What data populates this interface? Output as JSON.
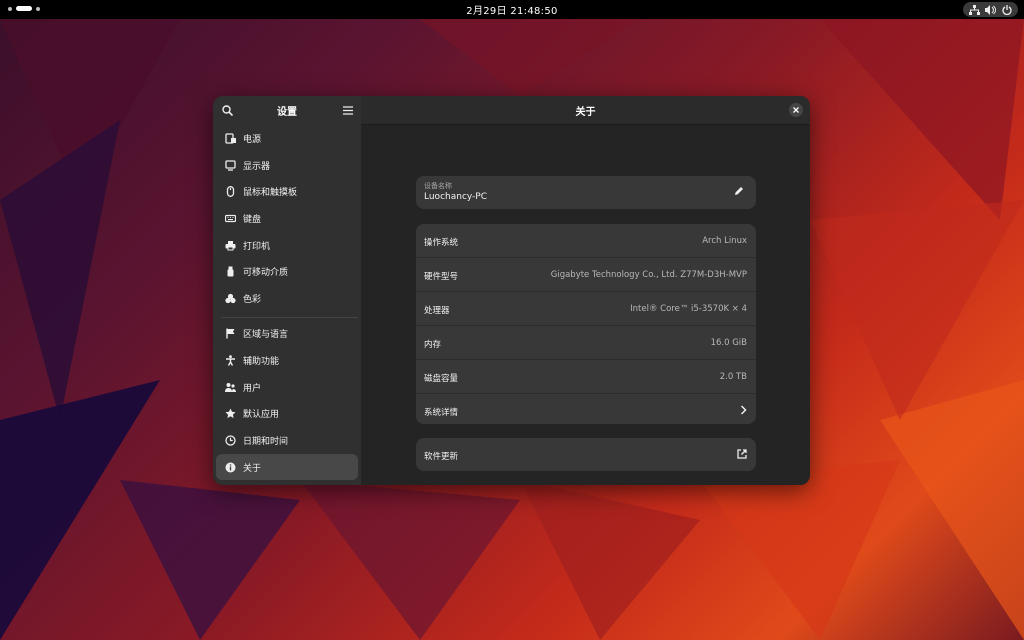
{
  "topbar": {
    "clock": "2月29日  21:48:50",
    "tray_icons": [
      "network-icon",
      "volume-icon",
      "power-icon"
    ]
  },
  "sidebar": {
    "title": "设置",
    "items": [
      {
        "label": "电源",
        "icon": "power-battery-icon"
      },
      {
        "label": "显示器",
        "icon": "display-icon"
      },
      {
        "label": "鼠标和触摸板",
        "icon": "mouse-icon"
      },
      {
        "label": "键盘",
        "icon": "keyboard-icon"
      },
      {
        "label": "打印机",
        "icon": "printer-icon"
      },
      {
        "label": "可移动介质",
        "icon": "removable-media-icon"
      },
      {
        "label": "色彩",
        "icon": "color-icon"
      },
      {
        "label": "区域与语言",
        "icon": "flag-icon"
      },
      {
        "label": "辅助功能",
        "icon": "accessibility-icon"
      },
      {
        "label": "用户",
        "icon": "users-icon"
      },
      {
        "label": "默认应用",
        "icon": "star-icon"
      },
      {
        "label": "日期和时间",
        "icon": "clock-icon"
      },
      {
        "label": "关于",
        "icon": "info-icon",
        "active": true
      }
    ]
  },
  "main": {
    "title": "关于",
    "device": {
      "label": "设备名称",
      "value": "Luochancy-PC"
    },
    "info": [
      {
        "label": "操作系统",
        "value": "Arch Linux"
      },
      {
        "label": "硬件型号",
        "value": "Gigabyte Technology Co., Ltd. Z77M-D3H-MVP"
      },
      {
        "label": "处理器",
        "value": "Intel® Core™ i5-3570K × 4"
      },
      {
        "label": "内存",
        "value": "16.0 GiB"
      },
      {
        "label": "磁盘容量",
        "value": "2.0 TB"
      },
      {
        "label": "系统详情",
        "value": ""
      }
    ],
    "software_update": "软件更新"
  },
  "colors": {
    "accent_bg": "#303030",
    "card": "#383838",
    "window": "#242424"
  }
}
